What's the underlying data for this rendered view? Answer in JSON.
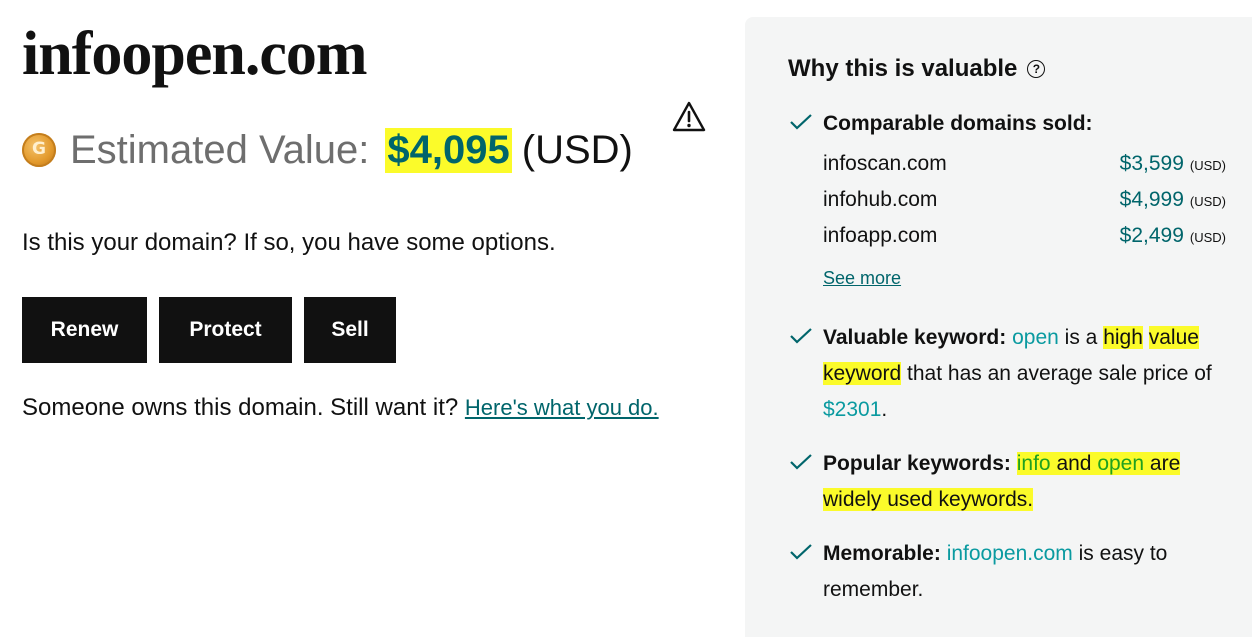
{
  "domain": "infoopen.com",
  "estimate": {
    "label": "Estimated Value:",
    "amount": "$4,095",
    "currency": "(USD)",
    "coin_icon": "coin-icon",
    "warning_icon": "warning-icon"
  },
  "question": "Is this your domain? If so, you have some options.",
  "buttons": {
    "renew": "Renew",
    "protect": "Protect",
    "sell": "Sell"
  },
  "owned": {
    "text": "Someone owns this domain. Still want it?",
    "link": "Here's what you do."
  },
  "panel": {
    "title": "Why this is valuable",
    "help_icon": "help-icon",
    "comparable": {
      "title": "Comparable domains sold:",
      "items": [
        {
          "domain": "infoscan.com",
          "price": "$3,599",
          "currency": "(USD)"
        },
        {
          "domain": "infohub.com",
          "price": "$4,999",
          "currency": "(USD)"
        },
        {
          "domain": "infoapp.com",
          "price": "$2,499",
          "currency": "(USD)"
        }
      ],
      "see_more": "See more"
    },
    "valuable": {
      "title": "Valuable keyword:",
      "keyword": "open",
      "t1": "is a",
      "t2": "high",
      "t3": "value keyword",
      "t4": "that has an average sale price of",
      "price": "$2301",
      "t5": "."
    },
    "popular": {
      "title": "Popular keywords:",
      "k1": "info",
      "and": "and",
      "k2": "open",
      "t1": "are",
      "t2": "widely used keywords."
    },
    "memorable": {
      "title": "Memorable:",
      "domain": "infoopen.com",
      "text": "is easy to remember."
    }
  },
  "colors": {
    "accent_teal": "#00656b",
    "link_teal": "#0a9aa0",
    "highlight": "#fbfb2a",
    "button_bg": "#111111",
    "panel_bg": "#f4f5f5"
  }
}
